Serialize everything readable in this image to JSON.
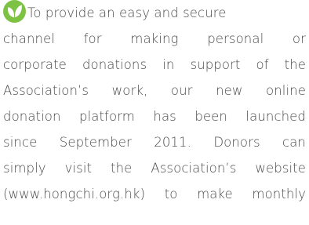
{
  "colors": {
    "icon_circle": "#7dc242",
    "icon_leaf": "#ffffff",
    "text": "#4a4a4a"
  },
  "icon": "leaf-icon",
  "paragraph": {
    "lines": [
      "To provide an easy and secure",
      "channel for making personal or",
      "corporate donations in support of the",
      "Association’s work, our new online",
      "donation platform has been launched",
      "since September 2011. Donors can",
      "simply visit the Association’s website",
      "(www.hongchi.org.hk) to make monthly"
    ]
  }
}
